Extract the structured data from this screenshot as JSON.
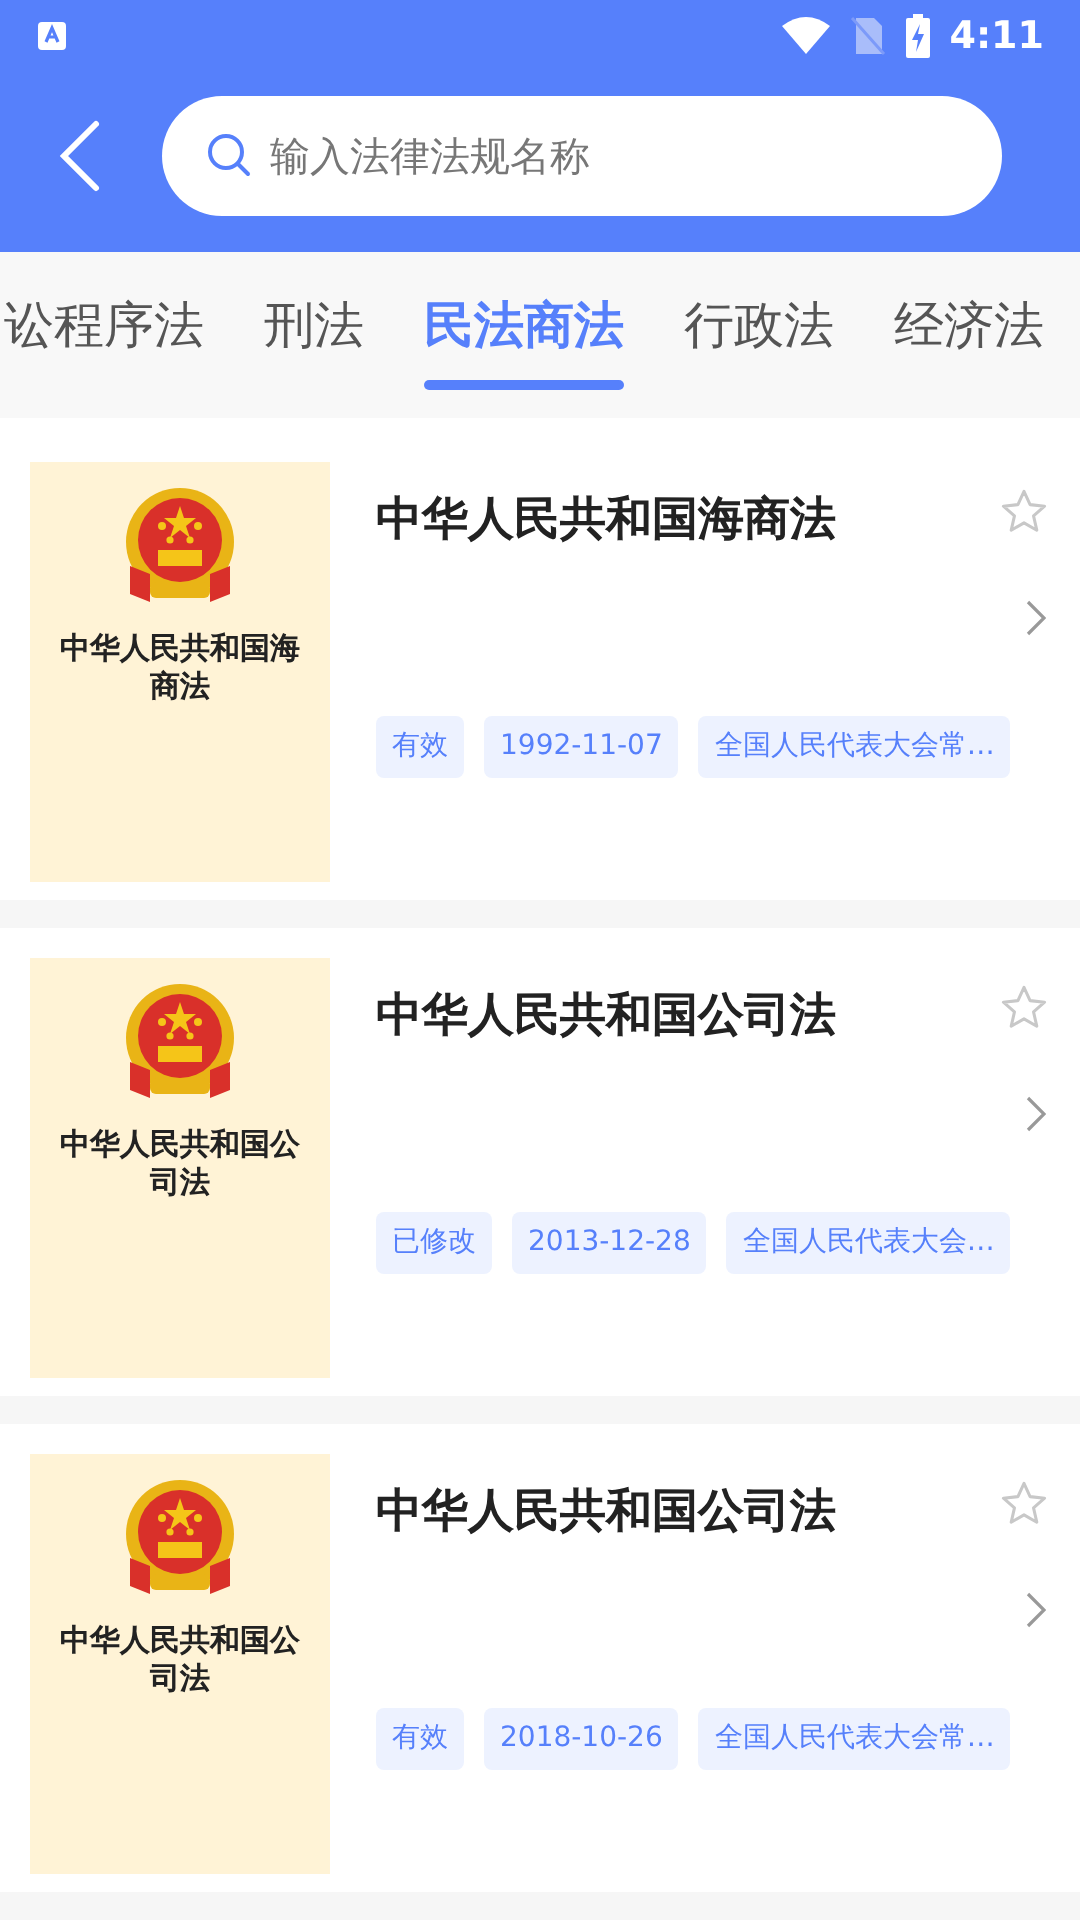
{
  "status_bar": {
    "time": "4:11"
  },
  "search": {
    "placeholder": "输入法律法规名称"
  },
  "tabs": [
    {
      "label": "讼程序法",
      "selected": false
    },
    {
      "label": "刑法",
      "selected": false
    },
    {
      "label": "民法商法",
      "selected": true
    },
    {
      "label": "行政法",
      "selected": false
    },
    {
      "label": "经济法",
      "selected": false
    }
  ],
  "laws": [
    {
      "cover_title": "中华人民共和国海商法",
      "title": "中华人民共和国海商法",
      "starred": false,
      "tags": [
        "有效",
        "1992-11-07",
        "全国人民代表大会常…"
      ]
    },
    {
      "cover_title": "中华人民共和国公司法",
      "title": "中华人民共和国公司法",
      "starred": false,
      "tags": [
        "已修改",
        "2013-12-28",
        "全国人民代表大会…"
      ]
    },
    {
      "cover_title": "中华人民共和国公司法",
      "title": "中华人民共和国公司法",
      "starred": false,
      "tags": [
        "有效",
        "2018-10-26",
        "全国人民代表大会常…"
      ]
    }
  ]
}
